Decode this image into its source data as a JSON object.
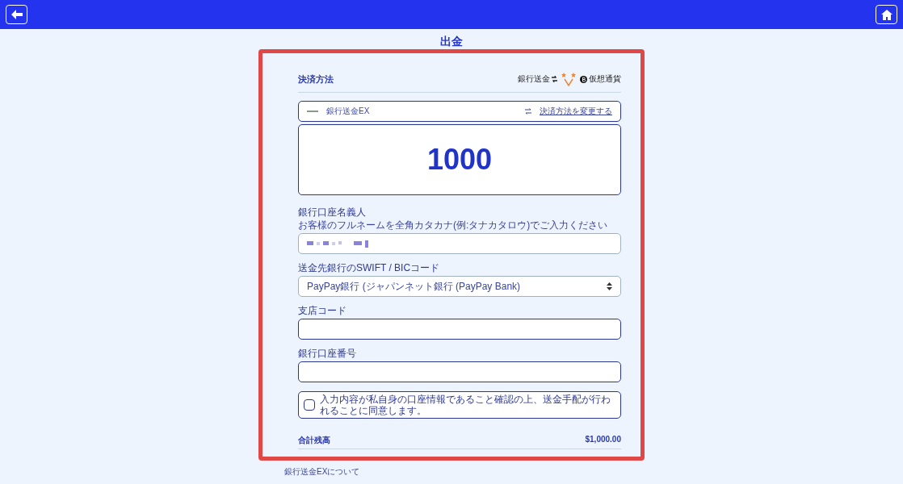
{
  "page_title": "出金",
  "payment_method": {
    "heading": "決済方法",
    "logos": [
      {
        "kind": "bank",
        "label": "銀行送金"
      },
      {
        "kind": "stars"
      },
      {
        "kind": "crypto",
        "label": "仮想通貨"
      }
    ],
    "method_name": "銀行送金EX",
    "change_link": "決済方法を変更する"
  },
  "amount": {
    "value": "1000"
  },
  "fields": [
    {
      "kind": "text",
      "label": "銀行口座名義人",
      "hint": "お客様のフルネームを全角カタカナ(例:タナカタロウ)でご入力ください",
      "blurred": true
    },
    {
      "kind": "select",
      "label": "送金先銀行のSWIFT / BICコード",
      "value": "PayPay銀行 (ジャパンネット銀行 (PayPay Bank)"
    },
    {
      "kind": "text",
      "label": "支店コード"
    },
    {
      "kind": "text",
      "label": "銀行口座番号"
    }
  ],
  "agreement": {
    "text": "入力内容が私自身の口座情報であること確認の上、送金手配が行われることに同意します。",
    "checked": false
  },
  "total": {
    "label": "合計残高",
    "value": "$1,000.00"
  },
  "footer_heading": "銀行送金EXについて"
}
